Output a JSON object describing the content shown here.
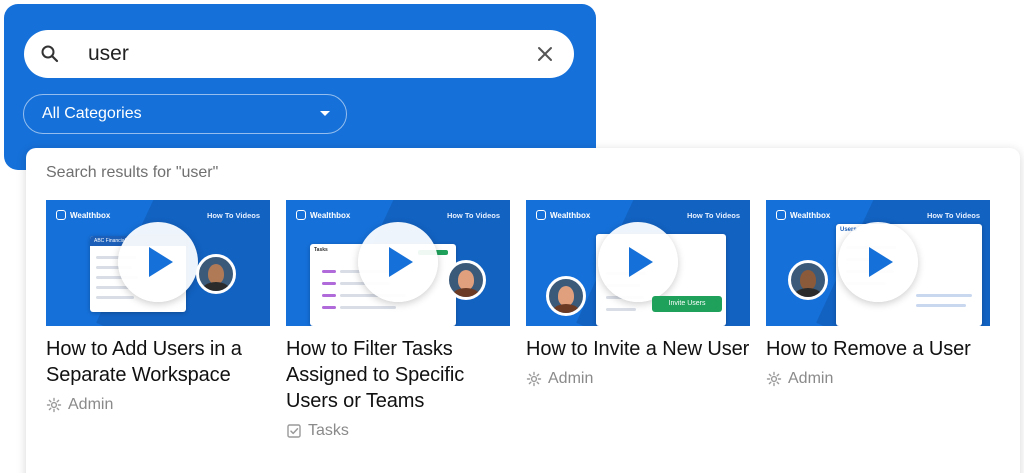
{
  "search": {
    "query": "user",
    "category": "All Categories"
  },
  "results": {
    "heading": "Search results for \"user\"",
    "items": [
      {
        "title": "How to Add Users in a Separate Workspace",
        "category": "Admin",
        "category_icon": "gear-icon",
        "thumb_brand": "Wealthbox",
        "thumb_tag": "How To Videos",
        "thumb_label": "ABC Financial"
      },
      {
        "title": "How to Filter Tasks Assigned to Specific Users or Teams",
        "category": "Tasks",
        "category_icon": "checkbox-icon",
        "thumb_brand": "Wealthbox",
        "thumb_tag": "How To Videos",
        "thumb_label": "Tasks"
      },
      {
        "title": "How to Invite a New User",
        "category": "Admin",
        "category_icon": "gear-icon",
        "thumb_brand": "Wealthbox",
        "thumb_tag": "How To Videos",
        "thumb_label": "Invite Users"
      },
      {
        "title": "How to Remove a User",
        "category": "Admin",
        "category_icon": "gear-icon",
        "thumb_brand": "Wealthbox",
        "thumb_tag": "How To Videos",
        "thumb_label": "Users"
      }
    ]
  },
  "colors": {
    "brand_blue": "#1570d9",
    "muted_text": "#8a8a8a",
    "title_text": "#111111",
    "invite_green": "#1fa15b"
  }
}
